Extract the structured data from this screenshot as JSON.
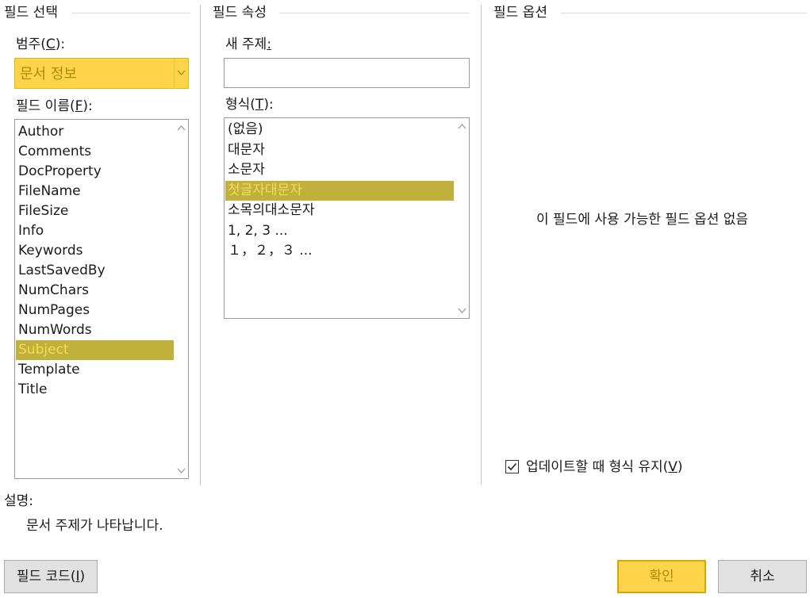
{
  "field_select": {
    "title": "필드 선택",
    "category_label": "범주(",
    "category_key": "C",
    "category_label_end": "):",
    "category_value": "문서 정보",
    "field_name_label": "필드 이름(",
    "field_name_key": "F",
    "field_name_label_end": "):",
    "field_names": [
      "Author",
      "Comments",
      "DocProperty",
      "FileName",
      "FileSize",
      "Info",
      "Keywords",
      "LastSavedBy",
      "NumChars",
      "NumPages",
      "NumWords",
      "Subject",
      "Template",
      "Title"
    ],
    "selected_field": "Subject"
  },
  "field_props": {
    "title": "필드 속성",
    "new_subject_label": "새 주제",
    "new_subject_colon": ":",
    "new_subject_value": "",
    "format_label": "형식(",
    "format_key": "T",
    "format_label_end": "):",
    "formats": [
      "(없음)",
      "대문자",
      "소문자",
      "첫글자대문자",
      "소목의대소문자",
      "1, 2, 3 ...",
      "１，２，３ ..."
    ],
    "selected_format": "첫글자대문자"
  },
  "field_options": {
    "title": "필드 옵션",
    "empty_message": "이 필드에 사용 가능한 필드 옵션 없음",
    "preserve_format_label": "업데이트할 때 형식 유지(",
    "preserve_format_key": "V",
    "preserve_format_label_end": ")",
    "preserve_format_checked": true
  },
  "description": {
    "label": "설명:",
    "text": "문서 주제가 나타납니다."
  },
  "buttons": {
    "field_codes": "필드 코드(",
    "field_codes_key": "I",
    "field_codes_end": ")",
    "ok": "확인",
    "cancel": "취소"
  },
  "colors": {
    "highlight": "#ffd44a",
    "selection": "#c0b03c"
  }
}
